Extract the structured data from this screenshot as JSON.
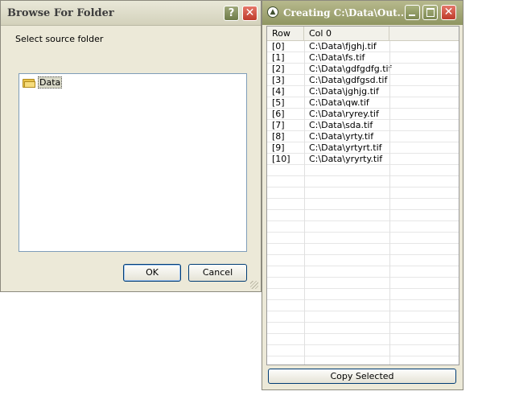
{
  "browse": {
    "title": "Browse For Folder",
    "help_glyph": "?",
    "close_glyph": "✕",
    "prompt": "Select source folder",
    "tree_item": "Data",
    "ok_label": "OK",
    "cancel_label": "Cancel"
  },
  "creating": {
    "title": "Creating C:\\Data\\Out...",
    "close_glyph": "✕",
    "columns": [
      "Row",
      "Col 0"
    ],
    "rows": [
      {
        "idx": "[0]",
        "val": "C:\\Data\\fjghj.tif"
      },
      {
        "idx": "[1]",
        "val": "C:\\Data\\fs.tif"
      },
      {
        "idx": "[2]",
        "val": "C:\\Data\\gdfgdfg.tif"
      },
      {
        "idx": "[3]",
        "val": "C:\\Data\\gdfgsd.tif"
      },
      {
        "idx": "[4]",
        "val": "C:\\Data\\jghjg.tif"
      },
      {
        "idx": "[5]",
        "val": "C:\\Data\\qw.tif"
      },
      {
        "idx": "[6]",
        "val": "C:\\Data\\ryrey.tif"
      },
      {
        "idx": "[7]",
        "val": "C:\\Data\\sda.tif"
      },
      {
        "idx": "[8]",
        "val": "C:\\Data\\yrty.tif"
      },
      {
        "idx": "[9]",
        "val": "C:\\Data\\yrtyrt.tif"
      },
      {
        "idx": "[10]",
        "val": "C:\\Data\\yryrty.tif"
      }
    ],
    "copy_label": "Copy Selected"
  }
}
